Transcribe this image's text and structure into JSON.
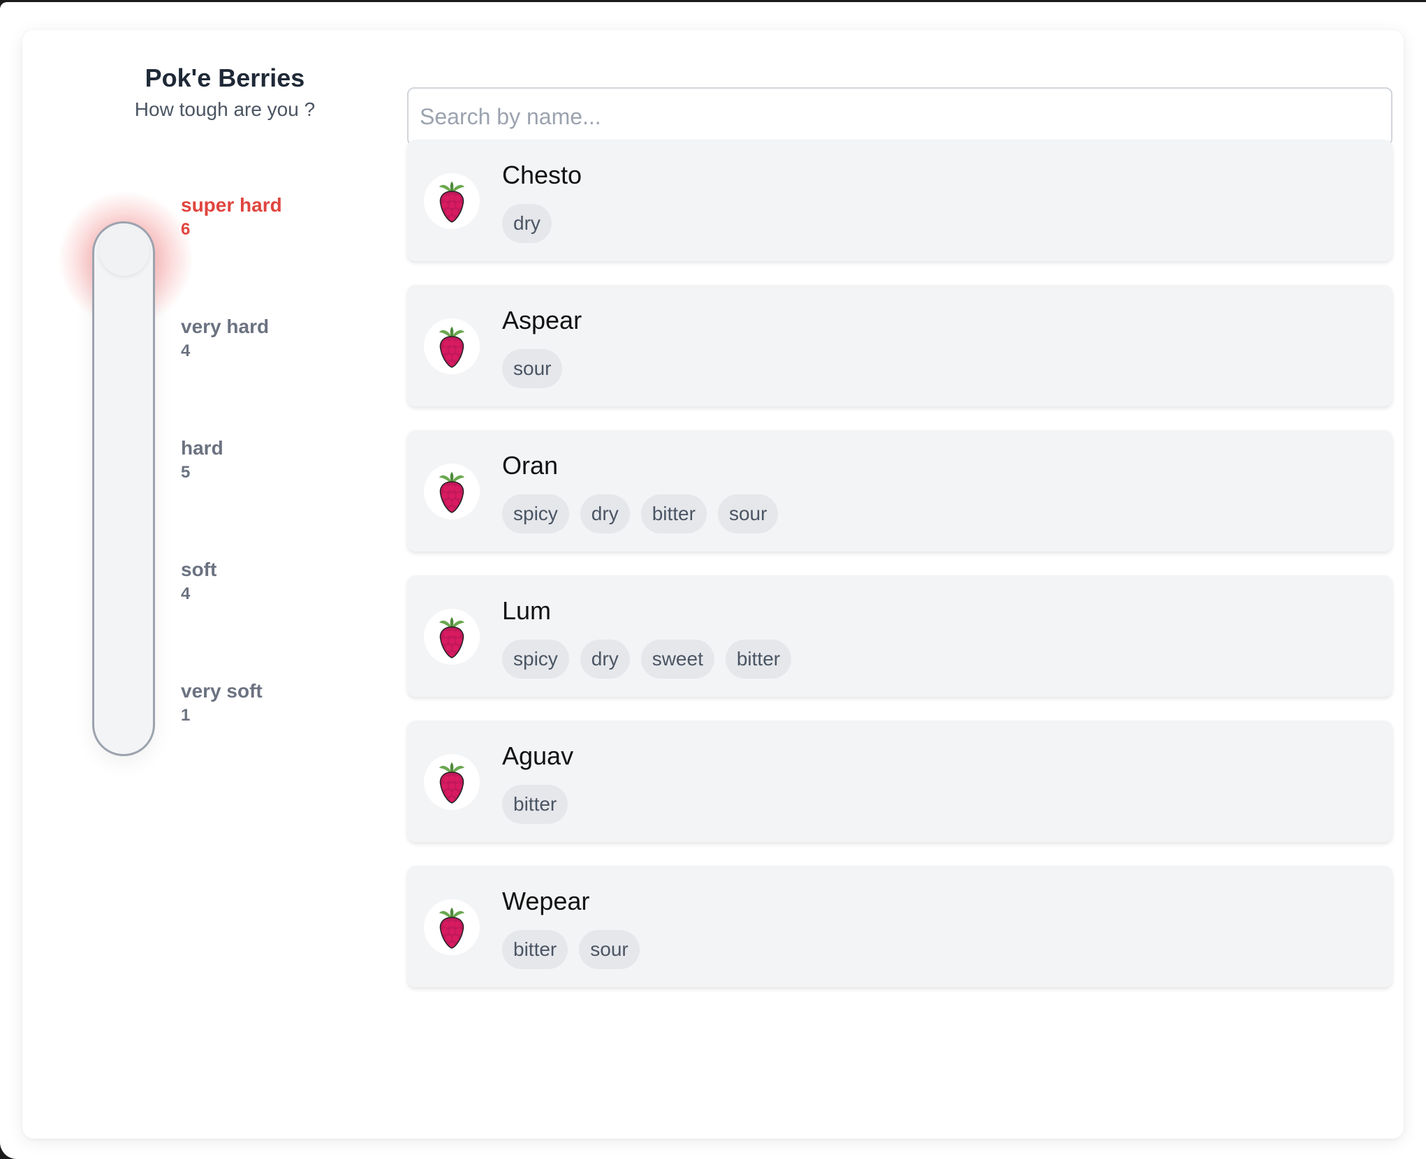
{
  "app": {
    "title": "Pok'e Berries",
    "subtitle": "How tough are you ?"
  },
  "firmness": {
    "selected": "super hard",
    "levels": [
      {
        "label": "super hard",
        "count": "6"
      },
      {
        "label": "very hard",
        "count": "4"
      },
      {
        "label": "hard",
        "count": "5"
      },
      {
        "label": "soft",
        "count": "4"
      },
      {
        "label": "very soft",
        "count": "1"
      }
    ]
  },
  "search": {
    "placeholder": "Search by name...",
    "value": ""
  },
  "berries": [
    {
      "name": "Chesto",
      "flavors": [
        "dry"
      ]
    },
    {
      "name": "Aspear",
      "flavors": [
        "sour"
      ]
    },
    {
      "name": "Oran",
      "flavors": [
        "spicy",
        "dry",
        "bitter",
        "sour"
      ]
    },
    {
      "name": "Lum",
      "flavors": [
        "spicy",
        "dry",
        "sweet",
        "bitter"
      ]
    },
    {
      "name": "Aguav",
      "flavors": [
        "bitter"
      ]
    },
    {
      "name": "Wepear",
      "flavors": [
        "bitter",
        "sour"
      ]
    }
  ],
  "icons": {
    "berry": "raspberry-icon"
  },
  "colors": {
    "accent": "#e0453f",
    "card_bg": "#f3f4f6",
    "tag_bg": "#e5e7eb"
  }
}
